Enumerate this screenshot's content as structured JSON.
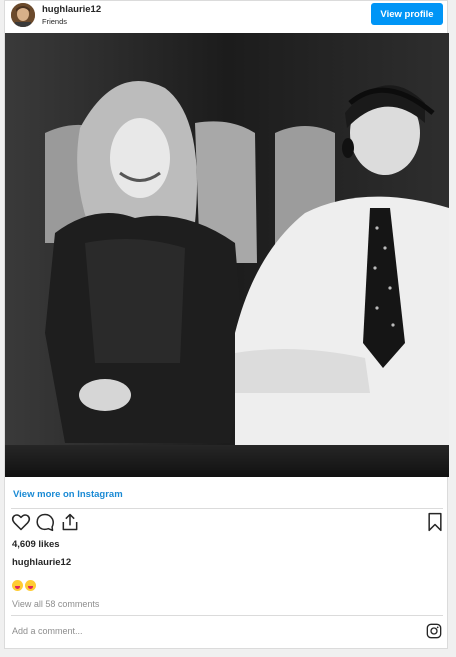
{
  "header": {
    "username": "hughlaurie12",
    "subtitle": "Friends",
    "view_profile_label": "View profile"
  },
  "post": {
    "view_more_label": "View more on Instagram",
    "likes_text": "4,609 likes",
    "caption_username": "hughlaurie12",
    "caption_emoji": "🤪🤪",
    "view_comments_label": "View all 58 comments",
    "add_comment_placeholder": "Add a comment..."
  },
  "actions": {
    "icons": [
      "heart-icon",
      "comment-icon",
      "share-icon",
      "bookmark-icon",
      "instagram-icon"
    ]
  },
  "colors": {
    "accent": "#0095f6",
    "link": "#1a8ad4",
    "muted_text": "#8e8e8e",
    "border": "#dbdbdb"
  }
}
